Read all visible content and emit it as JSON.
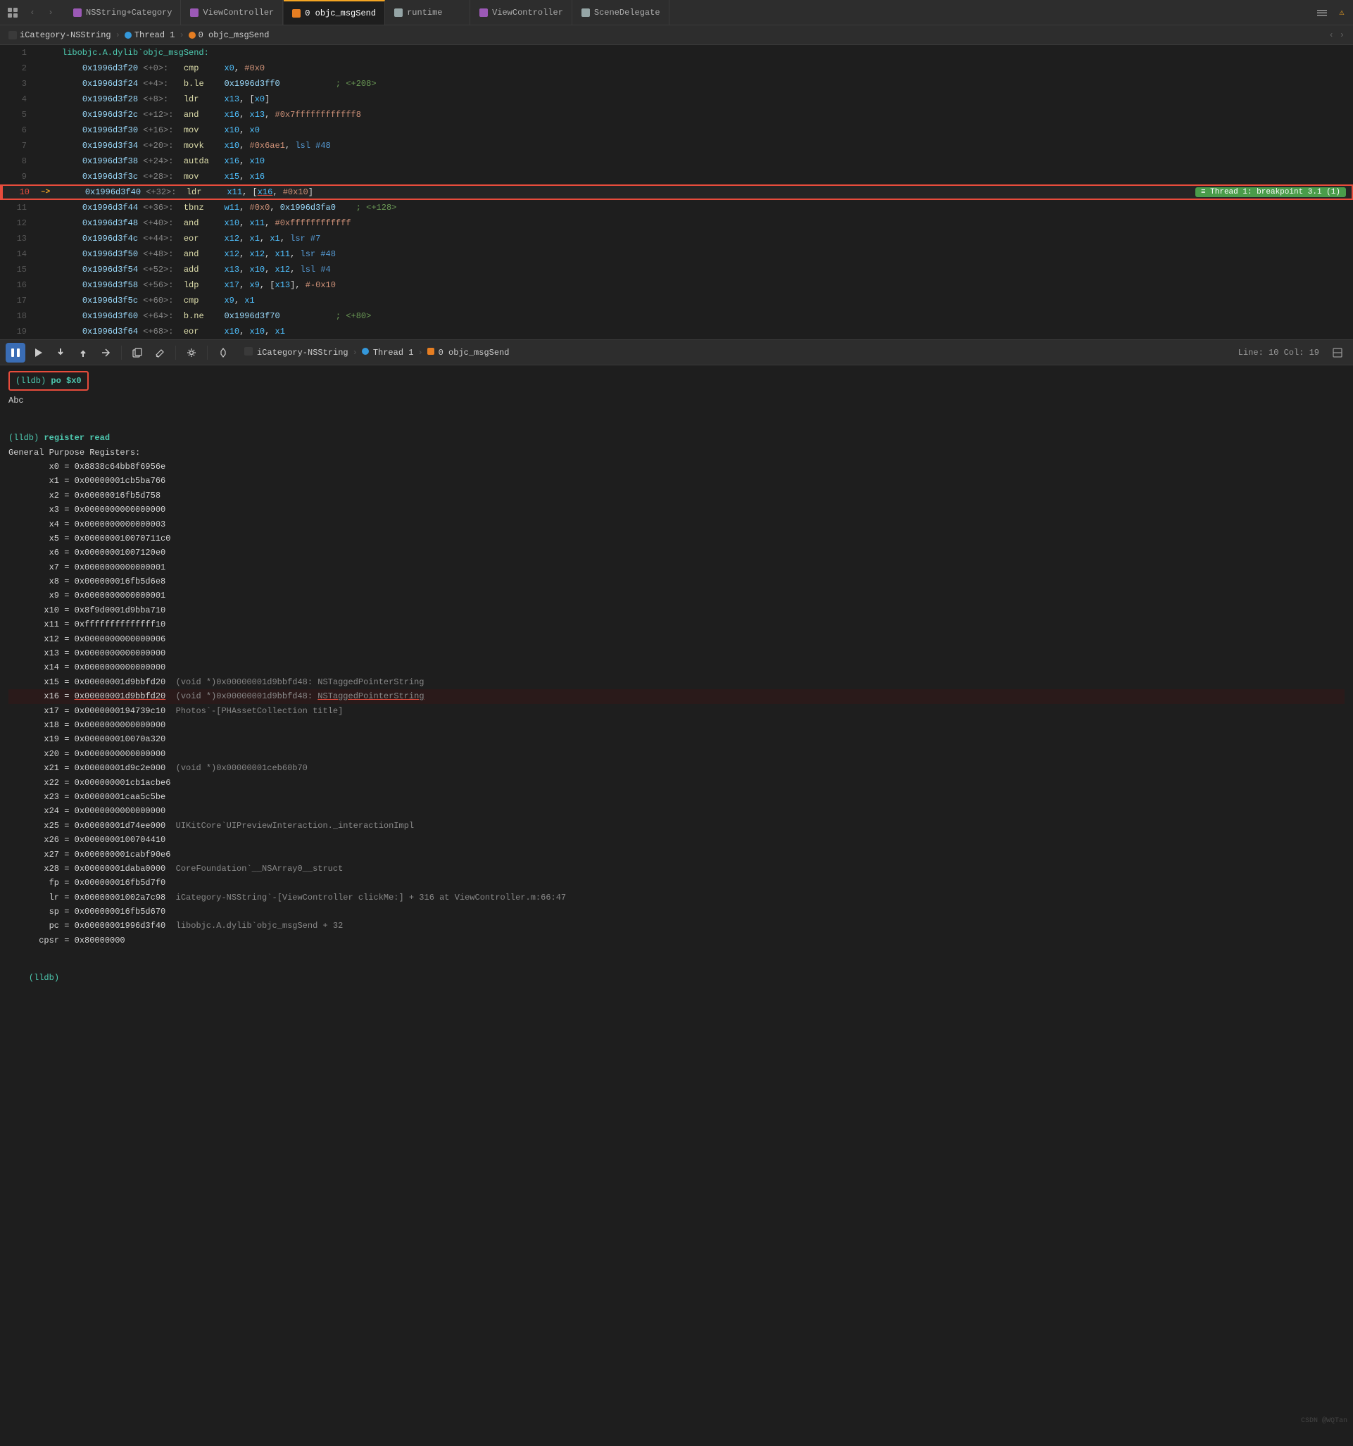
{
  "tabs": [
    {
      "id": "t1",
      "icon": "purple",
      "label": "NSString+Category",
      "active": false,
      "closeable": false
    },
    {
      "id": "t2",
      "icon": "purple",
      "label": "ViewController",
      "active": false,
      "closeable": false
    },
    {
      "id": "t3",
      "icon": "orange",
      "label": "0 objc_msgSend",
      "active": true,
      "closeable": false
    },
    {
      "id": "t4",
      "icon": "gray",
      "label": "runtime",
      "active": false,
      "closeable": false
    },
    {
      "id": "t5",
      "icon": "purple",
      "label": "ViewController",
      "active": false,
      "closeable": false
    },
    {
      "id": "t6",
      "icon": "gray",
      "label": "SceneDelegate",
      "active": false,
      "closeable": false
    }
  ],
  "breadcrumb": {
    "items": [
      {
        "label": "iCategory-NSString",
        "icon": "none"
      },
      {
        "label": "Thread 1",
        "icon": "blue"
      },
      {
        "label": "0 objc_msgSend",
        "icon": "orange"
      }
    ]
  },
  "code_lines": [
    {
      "num": 1,
      "addr": "",
      "offset": "",
      "instr": "libobjc.A.dylib`objc_msgSend:",
      "parts": []
    },
    {
      "num": 2,
      "addr": "0x1996d3f20",
      "offset": "<+0>:",
      "instr": "cmp",
      "op1": "x0,",
      "op2": "#0x0"
    },
    {
      "num": 3,
      "addr": "0x1996d3f24",
      "offset": "<+4>:",
      "instr": "b.le",
      "op1": "0x1996d3ff0",
      "comment": "; <+208>"
    },
    {
      "num": 4,
      "addr": "0x1996d3f28",
      "offset": "<+8>:",
      "instr": "ldr",
      "op1": "x13,",
      "op2": "[x0]"
    },
    {
      "num": 5,
      "addr": "0x1996d3f2c",
      "offset": "<+12>:",
      "instr": "and",
      "op1": "x16,",
      "op2": "x13,",
      "op3": "#0x7ffffffffffff8"
    },
    {
      "num": 6,
      "addr": "0x1996d3f30",
      "offset": "<+16>:",
      "instr": "mov",
      "op1": "x10,",
      "op2": "x0"
    },
    {
      "num": 7,
      "addr": "0x1996d3f34",
      "offset": "<+20>:",
      "instr": "movk",
      "op1": "x10,",
      "op2": "#0x6ae1,",
      "op3": "lsl #48"
    },
    {
      "num": 8,
      "addr": "0x1996d3f38",
      "offset": "<+24>:",
      "instr": "autda",
      "op1": "x16,",
      "op2": "x10"
    },
    {
      "num": 9,
      "addr": "0x1996d3f3c",
      "offset": "<+28>:",
      "instr": "mov",
      "op1": "x15,",
      "op2": "x16"
    },
    {
      "num": 10,
      "addr": "0x1996d3f40",
      "offset": "<+32>:",
      "instr": "ldr",
      "op1": "x11,",
      "op2": "[x16, #0x10]",
      "arrow": "->",
      "breakpoint": "Thread 1: breakpoint 3.1 (1)"
    },
    {
      "num": 11,
      "addr": "0x1996d3f44",
      "offset": "<+36>:",
      "instr": "tbnz",
      "op1": "w11,",
      "op2": "#0x0,",
      "op3": "0x1996d3fa0",
      "comment": "; <+128>"
    },
    {
      "num": 12,
      "addr": "0x1996d3f48",
      "offset": "<+40>:",
      "instr": "and",
      "op1": "x10,",
      "op2": "x11,",
      "op3": "#0xffffffffffff"
    },
    {
      "num": 13,
      "addr": "0x1996d3f4c",
      "offset": "<+44>:",
      "instr": "eor",
      "op1": "x12,",
      "op2": "x1,",
      "op3": "x1,",
      "op4": "lsr #7"
    },
    {
      "num": 14,
      "addr": "0x1996d3f50",
      "offset": "<+48>:",
      "instr": "and",
      "op1": "x12,",
      "op2": "x12,",
      "op3": "x11,",
      "op4": "lsr #48"
    },
    {
      "num": 15,
      "addr": "0x1996d3f54",
      "offset": "<+52>:",
      "instr": "add",
      "op1": "x13,",
      "op2": "x10,",
      "op3": "x12,",
      "op4": "lsl #4"
    },
    {
      "num": 16,
      "addr": "0x1996d3f58",
      "offset": "<+56>:",
      "instr": "ldp",
      "op1": "x17,",
      "op2": "x9,",
      "op3": "[x13], #-0x10"
    },
    {
      "num": 17,
      "addr": "0x1996d3f5c",
      "offset": "<+60>:",
      "instr": "cmp",
      "op1": "x9,",
      "op2": "x1"
    },
    {
      "num": 18,
      "addr": "0x1996d3f60",
      "offset": "<+64>:",
      "instr": "b.ne",
      "op1": "0x1996d3f70",
      "comment": "; <+80>"
    },
    {
      "num": 19,
      "addr": "0x1996d3f64",
      "offset": "<+68>:",
      "instr": "eor",
      "op1": "x10,",
      "op2": "x10,",
      "op3": "x1"
    }
  ],
  "debug_toolbar": {
    "breadcrumb": "iCategory-NSString  >  Thread 1  >  0 objc_msgSend",
    "position": "Line: 10  Col: 19"
  },
  "terminal": {
    "cmd1": "(lldb) po $x0",
    "result1": "Abc",
    "cmd2": "(lldb) register read",
    "result2": "General Purpose Registers:",
    "registers": [
      {
        "name": "x0",
        "value": "0x8838c64bb8f6956e"
      },
      {
        "name": "x1",
        "value": "0x00000001cb5ba766"
      },
      {
        "name": "x2",
        "value": "0x00000016fb5d758"
      },
      {
        "name": "x3",
        "value": "0x0000000000000000"
      },
      {
        "name": "x4",
        "value": "0x0000000000000003"
      },
      {
        "name": "x5",
        "value": "0x000000010070711c0"
      },
      {
        "name": "x6",
        "value": "0x00000001007120e0"
      },
      {
        "name": "x7",
        "value": "0x0000000000000001"
      },
      {
        "name": "x8",
        "value": "0x000000016fb5d6e8"
      },
      {
        "name": "x9",
        "value": "0x0000000000000001"
      },
      {
        "name": "x10",
        "value": "0x8f9d0001d9bba710"
      },
      {
        "name": "x11",
        "value": "0xffffffffffffff10"
      },
      {
        "name": "x12",
        "value": "0x0000000000000006"
      },
      {
        "name": "x13",
        "value": "0x0000000000000000"
      },
      {
        "name": "x14",
        "value": "0x0000000000000000"
      },
      {
        "name": "x15",
        "value": "0x00000001d9bbfd20",
        "annotation": "(void *)0x00000001d9bbfd48: NSTaggedPointerString"
      },
      {
        "name": "x16",
        "value": "0x00000001d9bbfd20",
        "annotation": "(void *)0x00000001d9bbfd48: NSTaggedPointerString",
        "highlight": true
      },
      {
        "name": "x17",
        "value": "0x0000000194739c10",
        "annotation": "Photos`-[PHAssetCollection title]"
      },
      {
        "name": "x18",
        "value": "0x0000000000000000"
      },
      {
        "name": "x19",
        "value": "0x000000010070a320"
      },
      {
        "name": "x20",
        "value": "0x0000000000000000"
      },
      {
        "name": "x21",
        "value": "0x00000001d9c2e000",
        "annotation": "(void *)0x00000001ceb60b70"
      },
      {
        "name": "x22",
        "value": "0x000000001cb1acbe6"
      },
      {
        "name": "x23",
        "value": "0x00000001caa5c5be"
      },
      {
        "name": "x24",
        "value": "0x0000000000000000"
      },
      {
        "name": "x25",
        "value": "0x00000001d74ee000",
        "annotation": "UIKitCore`UIPreviewInteraction._interactionImpl"
      },
      {
        "name": "x26",
        "value": "0x0000000100704410"
      },
      {
        "name": "x27",
        "value": "0x000000001cabf90e6"
      },
      {
        "name": "x28",
        "value": "0x00000001daba0000",
        "annotation": "CoreFoundation`__NSArray0__struct"
      },
      {
        "name": "fp",
        "value": "0x000000016fb5d7f0"
      },
      {
        "name": "lr",
        "value": "0x00000001002a7c98",
        "annotation": "iCategory-NSString`-[ViewController clickMe:] + 316 at ViewController.m:66:47"
      },
      {
        "name": "sp",
        "value": "0x000000016fb5d670"
      },
      {
        "name": "pc",
        "value": "0x00000001996d3f40",
        "annotation": "libobjc.A.dylib`objc_msgSend + 32"
      },
      {
        "name": "cpsr",
        "value": "0x80000000"
      }
    ]
  },
  "bottom_prompt": "(lldb)",
  "watermark": "CSDN @WQTan"
}
